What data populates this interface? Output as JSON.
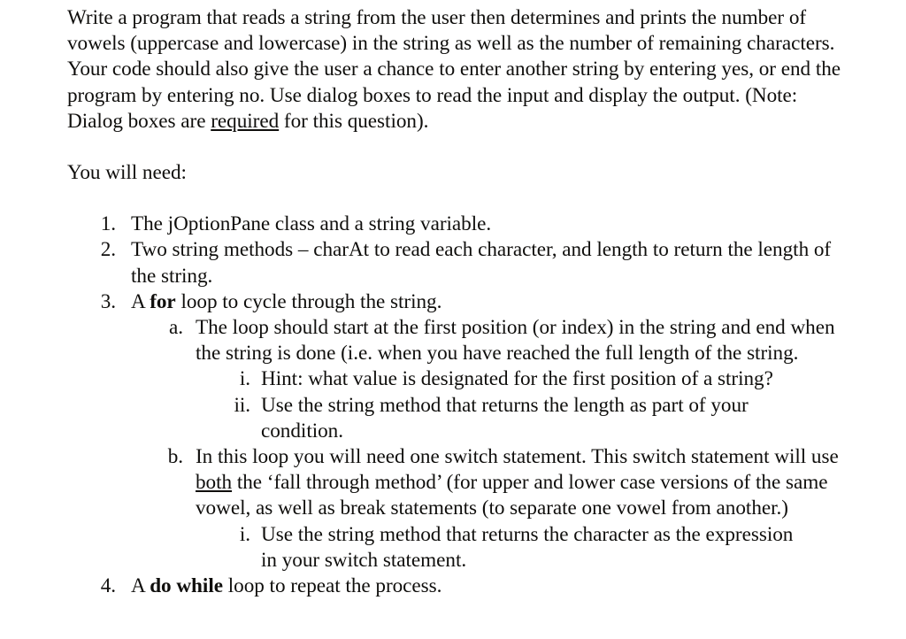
{
  "document": {
    "background_color": "#ffffff",
    "text_color": "#100f0d",
    "intro_paragraph": {
      "before_underline": "Write a program that reads a string from the user then determines and prints the number of vowels (uppercase and lowercase) in the string as well as the number of remaining characters. Your code should also give the user a chance to enter another string by entering yes, or end the program by entering no. Use dialog boxes to read the input and display the output. (Note: Dialog boxes are ",
      "underlined_word": "required",
      "after_underline": " for this question)."
    },
    "lead_in": "You will need:",
    "list": [
      {
        "marker": "1.",
        "level": 1,
        "text": "The jOptionPane class and a string variable."
      },
      {
        "marker": "2.",
        "level": 1,
        "text": "Two string methods – charAt to read each character, and length to return the length of the string."
      },
      {
        "marker": "3.",
        "level": 1,
        "text_before_bold": "A ",
        "bold_word": "for",
        "text_after_bold": " loop to cycle through the string."
      },
      {
        "marker": "a.",
        "level": 2,
        "text": "The loop should start at the first position (or index) in the string and end when the string is done (i.e. when you have reached the full length of the string."
      },
      {
        "marker": "i.",
        "level": 3,
        "text": "Hint: what value is designated for the first position of a string?"
      },
      {
        "marker": "ii.",
        "level": 3,
        "text": "Use the string method that returns the length as part of your condition."
      },
      {
        "marker": "b.",
        "level": 2,
        "text_before_underline": "In this loop you will need one switch statement. This switch statement will use ",
        "underlined_word": "both",
        "text_after_underline": " the ‘fall through method’ (for upper and lower case versions of the same vowel, as well as break statements (to separate one vowel from another.)"
      },
      {
        "marker": "i.",
        "level": 3,
        "text": "Use the string method that returns the character as the expression in your switch statement."
      },
      {
        "marker": "4.",
        "level": 1,
        "text_before_bold": "A ",
        "bold_word": "do while",
        "text_after_bold": " loop to repeat the process."
      }
    ]
  }
}
